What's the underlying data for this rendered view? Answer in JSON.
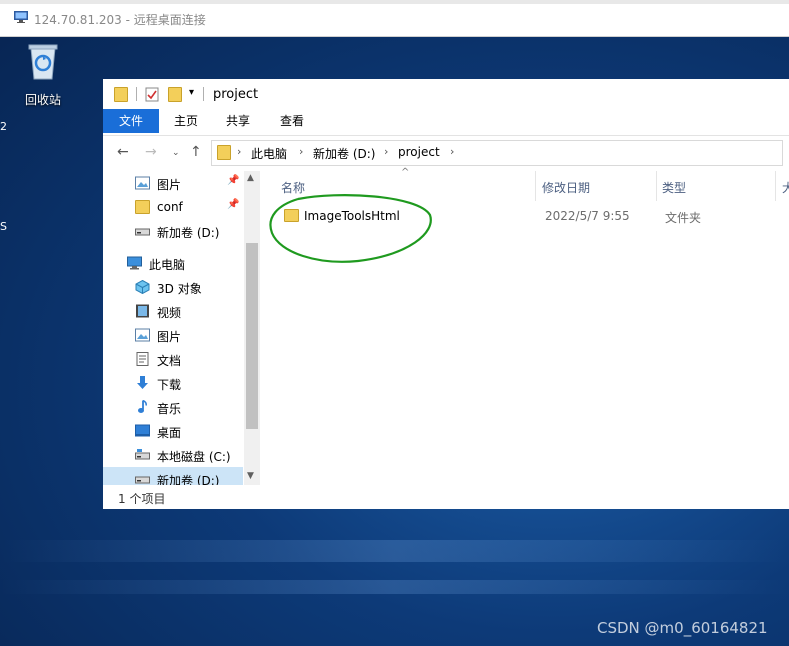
{
  "rdp": {
    "title": "124.70.81.203 - 远程桌面连接",
    "icon": "remote-desktop-icon"
  },
  "desktop": {
    "recycle_bin_label": "回收站"
  },
  "explorer": {
    "window_title": "project",
    "ribbon_tabs": [
      "文件",
      "主页",
      "共享",
      "查看"
    ],
    "breadcrumb": [
      "此电脑",
      "新加卷 (D:)",
      "project"
    ],
    "nav_items": [
      {
        "label": "图片",
        "icon": "pictures-icon",
        "pinned": true
      },
      {
        "label": "conf",
        "icon": "folder-icon",
        "pinned": true
      },
      {
        "label": "新加卷 (D:)",
        "icon": "drive-icon",
        "pinned": false
      },
      {
        "label": "此电脑",
        "icon": "this-pc-icon",
        "pinned": false
      },
      {
        "label": "3D 对象",
        "icon": "3d-objects-icon",
        "pinned": false
      },
      {
        "label": "视频",
        "icon": "videos-icon",
        "pinned": false
      },
      {
        "label": "图片",
        "icon": "pictures-icon",
        "pinned": false
      },
      {
        "label": "文档",
        "icon": "documents-icon",
        "pinned": false
      },
      {
        "label": "下载",
        "icon": "downloads-icon",
        "pinned": false
      },
      {
        "label": "音乐",
        "icon": "music-icon",
        "pinned": false
      },
      {
        "label": "桌面",
        "icon": "desktop-icon",
        "pinned": false
      },
      {
        "label": "本地磁盘 (C:)",
        "icon": "drive-icon",
        "pinned": false
      },
      {
        "label": "新加卷 (D:)",
        "icon": "drive-icon",
        "pinned": false,
        "selected": true
      }
    ],
    "columns": [
      "名称",
      "修改日期",
      "类型",
      "大"
    ],
    "files": [
      {
        "name": "ImageToolsHtml",
        "modified": "2022/5/7 9:55",
        "type": "文件夹"
      }
    ],
    "status": "1 个项目"
  },
  "watermark": "CSDN @m0_60164821",
  "colors": {
    "accent": "#1a6ed8",
    "annotation_circle": "#1f9a1f",
    "folder": "#f3cf5a"
  }
}
